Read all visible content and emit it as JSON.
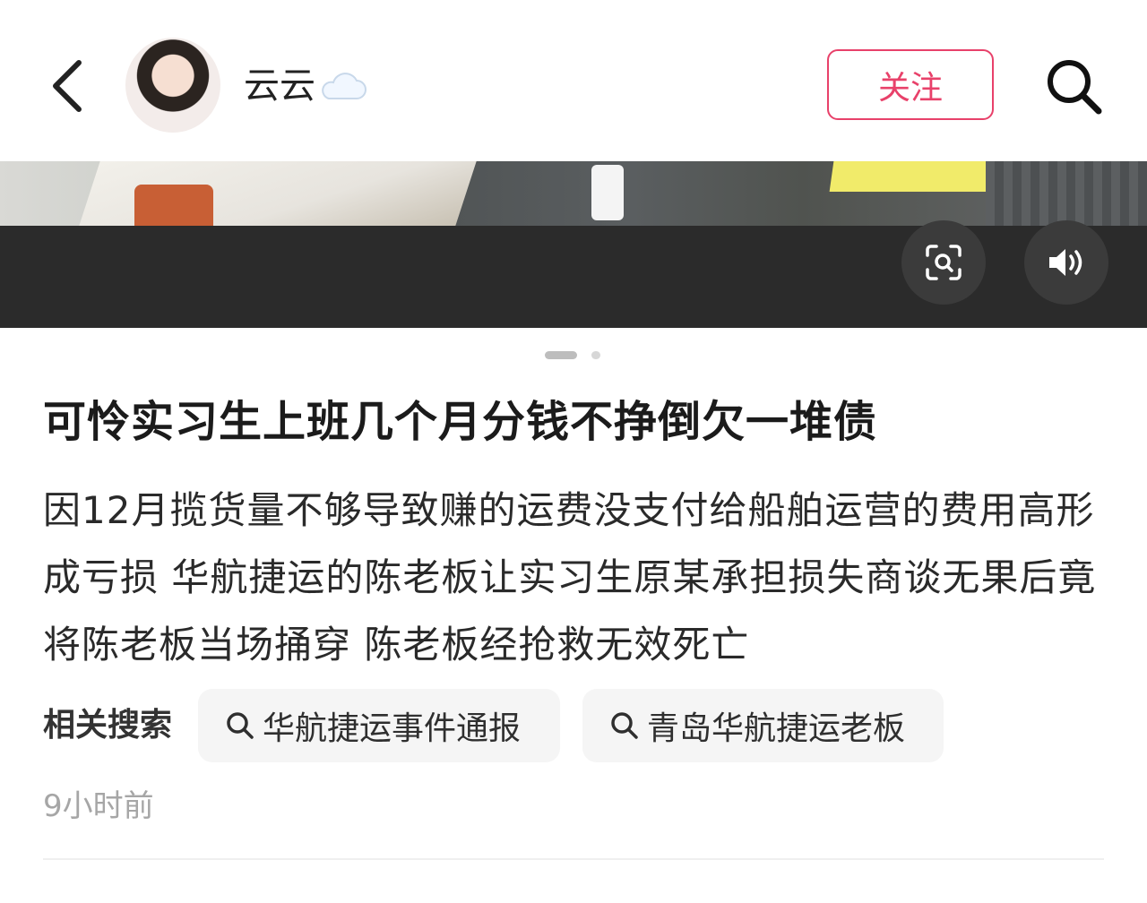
{
  "header": {
    "author_name": "云云",
    "follow_label": "关注"
  },
  "icons": {
    "back": "chevron-left-icon",
    "cloud": "cloud-icon",
    "search": "search-icon",
    "scan": "scan-icon",
    "sound": "volume-icon"
  },
  "colors": {
    "accent": "#e8416a",
    "chip_bg": "#f5f5f5",
    "timestamp": "#a6a6a6"
  },
  "carousel": {
    "page_count": 2,
    "current_page": 1
  },
  "post": {
    "title": "可怜实习生上班几个月分钱不挣倒欠一堆债",
    "body": "因12月揽货量不够导致赚的运费没支付给船舶运营的费用高形成亏损 华航捷运的陈老板让实习生原某承担损失商谈无果后竟将陈老板当场捅穿 陈老板经抢救无效死亡",
    "time": "9小时前"
  },
  "related": {
    "label": "相关搜索",
    "items": [
      {
        "label": "华航捷运事件通报"
      },
      {
        "label": "青岛华航捷运老板"
      }
    ]
  }
}
